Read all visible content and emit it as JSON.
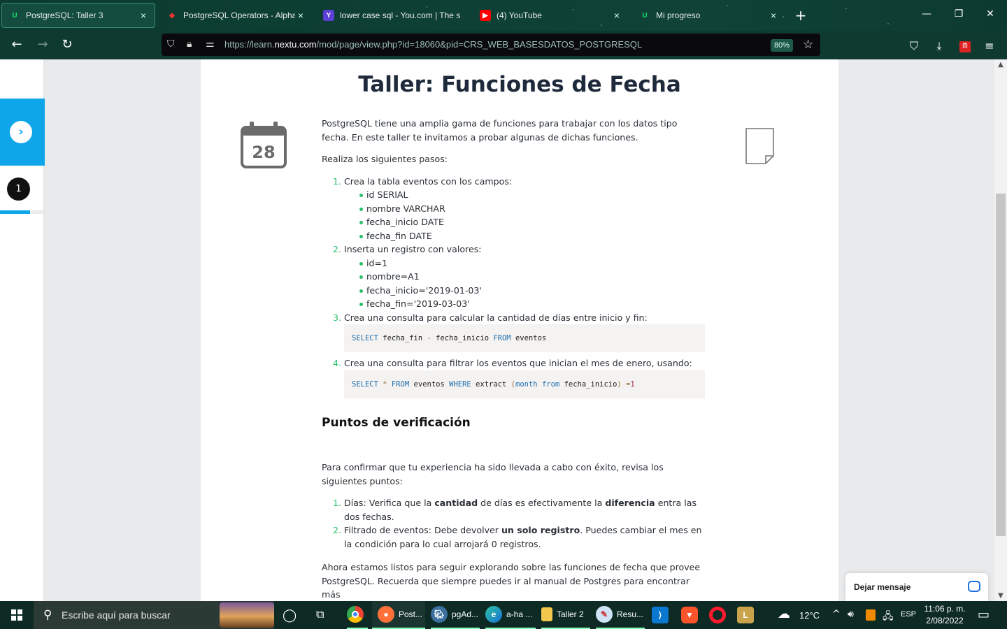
{
  "browser": {
    "tabs": [
      {
        "label": "PostgreSQL: Taller 3",
        "favicon": "udemy-u-icon",
        "active": true
      },
      {
        "label": "PostgreSQL Operators - AlphaC",
        "favicon": "postgres-tutorial-icon",
        "active": false
      },
      {
        "label": "lower case sql - You.com | The s",
        "favicon": "you-com-icon",
        "active": false
      },
      {
        "label": "(4) YouTube",
        "favicon": "youtube-icon",
        "active": false
      },
      {
        "label": "Mi progreso",
        "favicon": "udemy-u-icon",
        "active": false
      }
    ],
    "url_prefix": "https://learn.",
    "url_domain": "nextu.com",
    "url_path": "/mod/page/view.php?id=18060&pid=CRS_WEB_BASESDATOS_POSTGRESQL",
    "zoom": "80%"
  },
  "sidebar": {
    "step_number": "1",
    "progress_fraction": 0.7
  },
  "article": {
    "title": "Taller: Funciones de Fecha",
    "calendar_day": "28",
    "intro": "PostgreSQL tiene una amplia gama de funciones para trabajar con los datos tipo fecha.  En este taller te invitamos a probar algunas de dichas funciones.",
    "steps_intro": "Realiza los siguientes pasos:",
    "step1": "Crea la tabla eventos con los campos:",
    "step1_fields": [
      "id SERIAL",
      "nombre VARCHAR",
      "fecha_inicio DATE",
      "fecha_fin DATE"
    ],
    "step2": "Inserta un registro con valores:",
    "step2_values": [
      "id=1",
      "nombre=A1",
      "fecha_inicio='2019-01-03'",
      "fecha_fin='2019-03-03'"
    ],
    "step3": "Crea una consulta para calcular la cantidad de días entre inicio y fin:",
    "code1": {
      "kw1": "SELECT",
      "a": "fecha_fin",
      "op": "-",
      "b": "fecha_inicio",
      "kw2": "FROM",
      "t": "eventos"
    },
    "step4": "Crea una consulta para filtrar los eventos que inician el mes de enero, usando:",
    "code2": {
      "kw1": "SELECT",
      "star": "*",
      "kw2": "FROM",
      "t": "eventos",
      "kw3": "WHERE",
      "fn": "extract",
      "lp": "(",
      "kw4": "month",
      "kw5": "from",
      "col": "fecha_inicio",
      "rp": ")",
      "eq": "=",
      "num": "1"
    },
    "checkpoints_title": "Puntos de verificación",
    "checkpoints_intro": "Para confirmar que tu experiencia ha sido llevada a cabo con éxito, revisa los siguientes puntos:",
    "check1_pre": "Días: Verifica que la ",
    "check1_b1": "cantidad",
    "check1_mid": " de días es efectivamente la ",
    "check1_b2": "diferencia",
    "check1_post": " entra las dos fechas.",
    "check2_pre": "Filtrado de eventos: Debe devolver ",
    "check2_b": "un solo registro",
    "check2_post": ". Puedes cambiar el mes en la condición para lo cual arrojará 0 registros.",
    "footer": "Ahora estamos listos para seguir explorando sobre las funciones de fecha que provee PostgreSQL. Recuerda que siempre puedes ir al manual de Postgres para encontrar más"
  },
  "chat": {
    "label": "Dejar mensaje"
  },
  "taskbar": {
    "search_placeholder": "Escribe aquí para buscar",
    "apps": [
      {
        "label": "Post...",
        "icon": "firefox-icon"
      },
      {
        "label": "pgAd...",
        "icon": "pgadmin-icon"
      },
      {
        "label": "a-ha ...",
        "icon": "edge-icon"
      },
      {
        "label": "Taller 2",
        "icon": "folder-icon"
      },
      {
        "label": "Resu...",
        "icon": "paint-icon"
      }
    ],
    "temperature": "12°C",
    "language": "ESP",
    "time": "11:06 p. m.",
    "date": "2/08/2022"
  }
}
